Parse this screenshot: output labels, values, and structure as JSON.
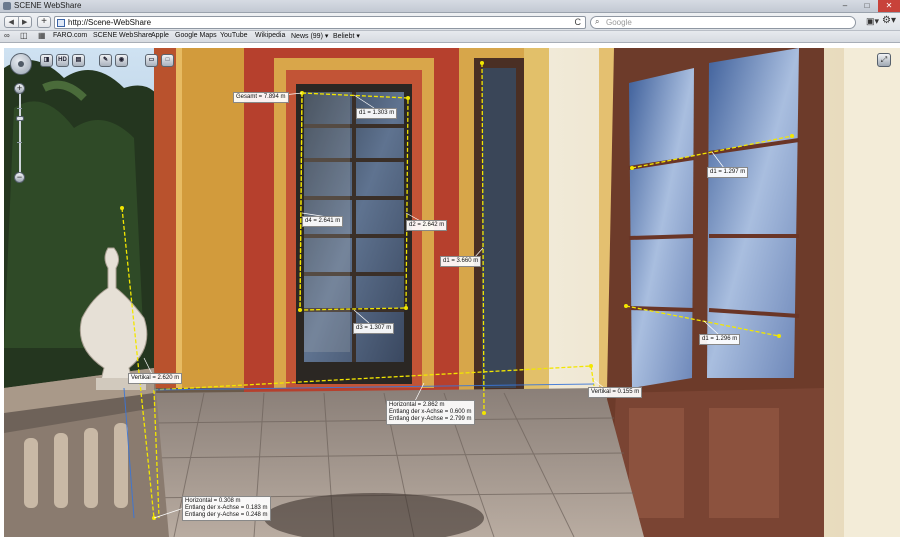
{
  "window": {
    "title": "SCENE WebShare"
  },
  "toolbar": {
    "back_label": "◀",
    "forward_label": "▶",
    "new_tab_label": "+",
    "url": "http://Scene-WebShare",
    "reload_label": "C",
    "search_placeholder": "Google"
  },
  "bookmarks": {
    "items": [
      {
        "label": "FARO.com"
      },
      {
        "label": "SCENE WebShare"
      },
      {
        "label": "Apple"
      },
      {
        "label": "Google Maps"
      },
      {
        "label": "YouTube"
      },
      {
        "label": "Wikipedia"
      },
      {
        "label": "News (99) ▾"
      },
      {
        "label": "Beliebt ▾"
      }
    ]
  },
  "viewer": {
    "hd_label": "HD",
    "zoom_in_label": "+",
    "zoom_out_label": "−"
  },
  "measurements": {
    "gesamt": "Gesamt = 7.894 m",
    "door_top": "d1 = 1.303 m",
    "door_left": "d4 = 2.641 m",
    "door_right": "d2 = 2.642 m",
    "door_bottom": "d3 = 1.307 m",
    "pillar": "d1 = 3.660 m",
    "window_upper": "d1 = 1.297 m",
    "window_lower": "d1 = 1.296 m",
    "vertikal_left": "Vertikal = 2.620 m",
    "vertikal_right": "Vertikal = 0.155 m",
    "floor_lines": [
      "Horizontal = 2.862 m",
      "Entlang der x-Achse = 0.600 m",
      "Entlang der y-Achse = 2.799 m"
    ],
    "corner_lines": [
      "Horizontal = 0.308 m",
      "Entlang der x-Achse = 0.183 m",
      "Entlang der y-Achse = 0.248 m"
    ]
  },
  "colors": {
    "measure_line": "#f2e600",
    "wall_red": "#b6402d",
    "wall_yellow": "#d4a23f"
  }
}
